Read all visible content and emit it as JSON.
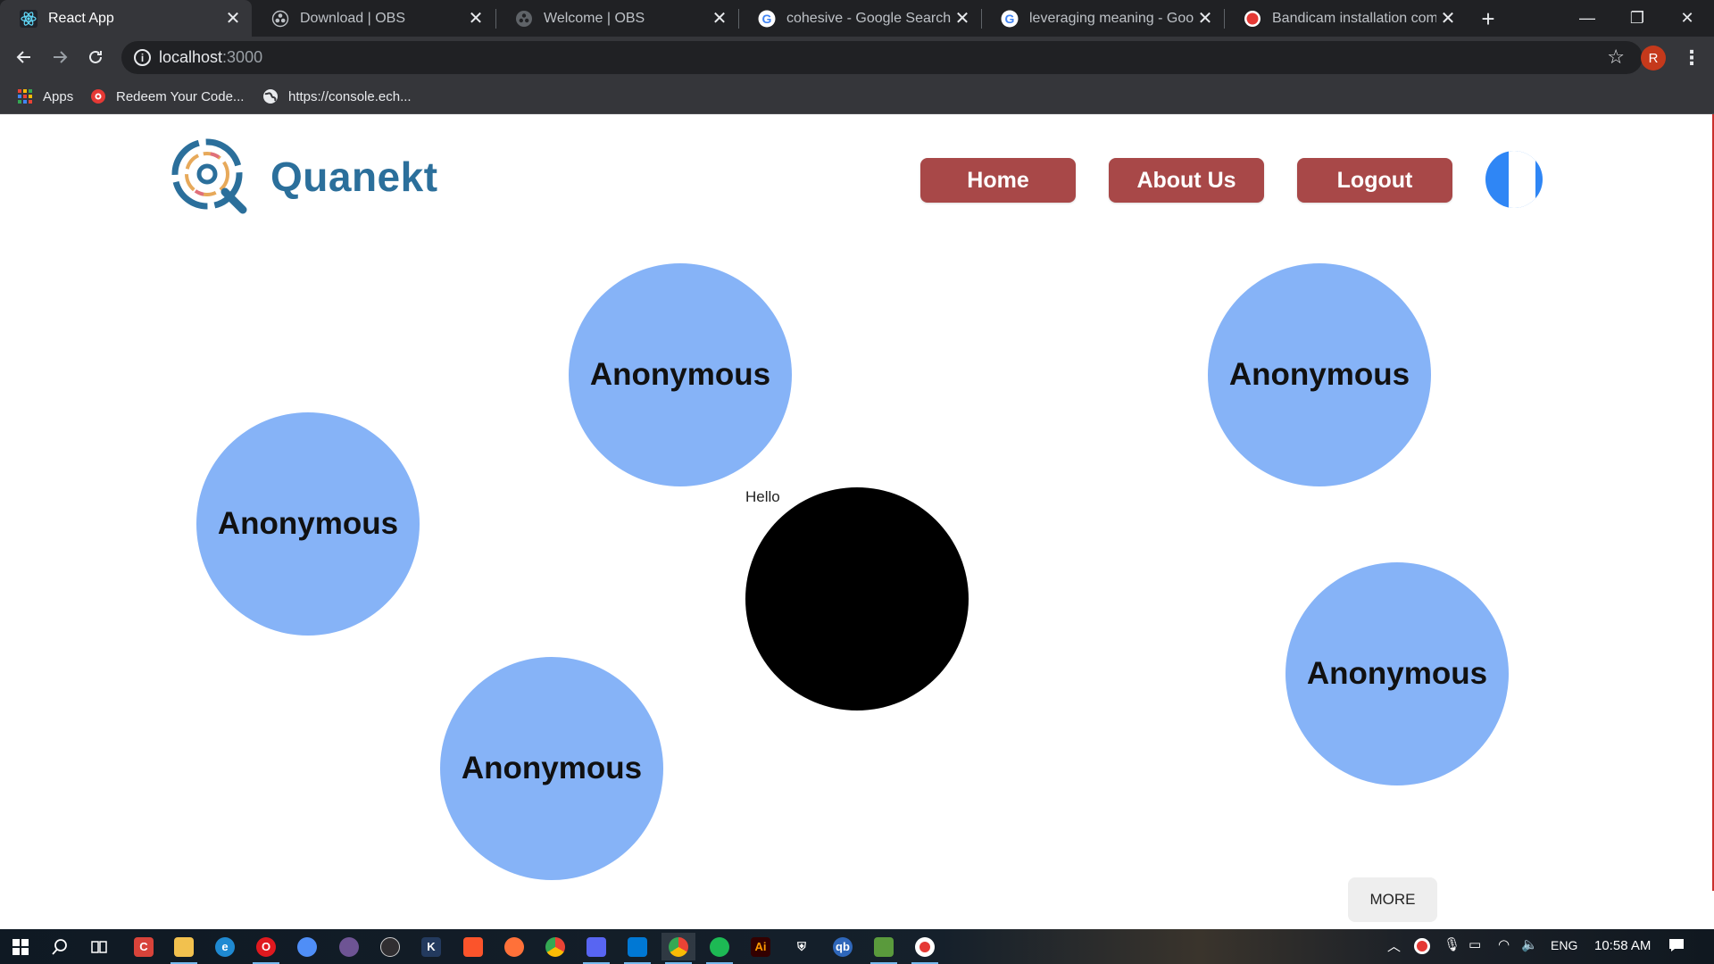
{
  "browser": {
    "tabs": [
      {
        "title": "React App",
        "favicon": "react-icon",
        "active": true
      },
      {
        "title": "Download | OBS",
        "favicon": "obs-icon",
        "active": false
      },
      {
        "title": "Welcome | OBS",
        "favicon": "obs-icon",
        "active": false
      },
      {
        "title": "cohesive - Google Search",
        "favicon": "google-icon",
        "active": false
      },
      {
        "title": "leveraging meaning - Google",
        "favicon": "google-icon",
        "active": false
      },
      {
        "title": "Bandicam installation comple",
        "favicon": "bandicam-icon",
        "active": false
      }
    ],
    "address": {
      "host": "localhost",
      "port": ":3000"
    },
    "profile_initial": "R",
    "bookmarks": [
      {
        "label": "Apps",
        "icon": "apps-grid-icon"
      },
      {
        "label": "Redeem Your Code...",
        "icon": "gear-badge-icon"
      },
      {
        "label": "https://console.ech...",
        "icon": "globe-icon"
      }
    ]
  },
  "site": {
    "brand": "Quanekt",
    "nav": {
      "home": "Home",
      "about": "About Us",
      "logout": "Logout"
    },
    "self_label": "Hello",
    "participants": [
      {
        "name": "Anonymous"
      },
      {
        "name": "Anonymous"
      },
      {
        "name": "Anonymous"
      },
      {
        "name": "Anonymous"
      },
      {
        "name": "Anonymous"
      }
    ],
    "more_label": "MORE",
    "colors": {
      "brand": "#2b6f9b",
      "nav_button": "#a84848",
      "bubble": "#86b3f7",
      "self_bubble": "#000000",
      "avatar": "#2f86f5"
    }
  },
  "taskbar": {
    "language": "ENG",
    "time": "10:58 AM"
  }
}
